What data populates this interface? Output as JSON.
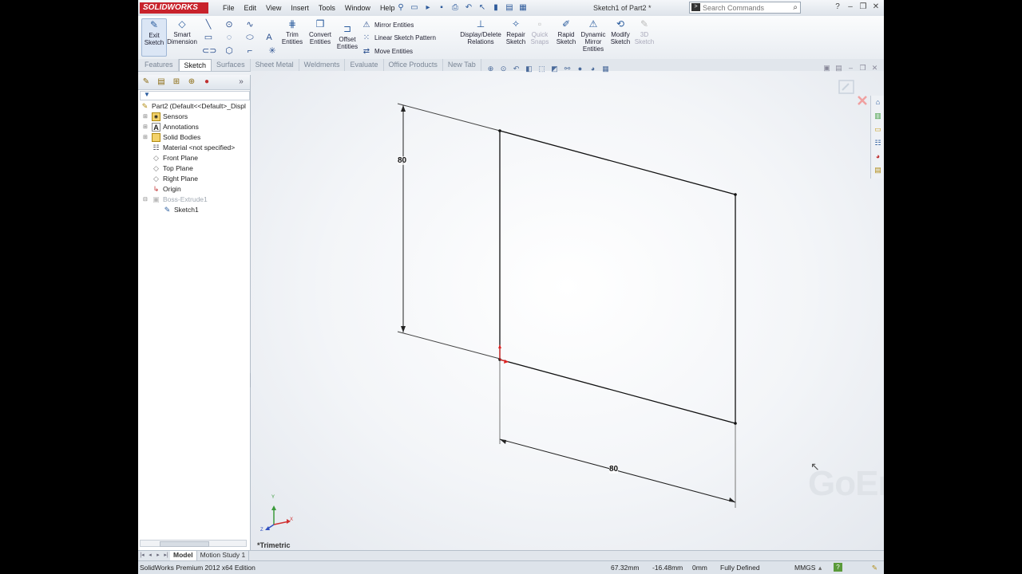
{
  "app": {
    "logo": "SOLIDWORKS",
    "document_title": "Sketch1 of Part2 *"
  },
  "menu": [
    "File",
    "Edit",
    "View",
    "Insert",
    "Tools",
    "Window",
    "Help"
  ],
  "search": {
    "placeholder": "Search Commands"
  },
  "ribbon": {
    "exit_sketch": "Exit Sketch",
    "smart_dimension": "Smart Dimension",
    "trim_entities": "Trim Entities",
    "convert_entities": "Convert Entities",
    "offset_entities": "Offset Entities",
    "mirror_entities": "Mirror Entities",
    "linear_sketch_pattern": "Linear Sketch Pattern",
    "move_entities": "Move Entities",
    "display_delete_relations": "Display/Delete Relations",
    "repair_sketch": "Repair Sketch",
    "quick_snaps": "Quick Snaps",
    "rapid_sketch": "Rapid Sketch",
    "dynamic_mirror_entities": "Dynamic Mirror Entities",
    "modify_sketch": "Modify Sketch",
    "sketch_3d": "3D Sketch"
  },
  "tabs": [
    "Features",
    "Sketch",
    "Surfaces",
    "Sheet Metal",
    "Weldments",
    "Evaluate",
    "Office Products",
    "New Tab"
  ],
  "active_tab": "Sketch",
  "tree": [
    {
      "label": "Part2  (Default<<Default>_Displ",
      "icon": "part-icon"
    },
    {
      "label": "Sensors",
      "icon": "sensor-icon"
    },
    {
      "label": "Annotations",
      "icon": "annotation-icon"
    },
    {
      "label": "Solid Bodies",
      "icon": "solid-bodies-icon"
    },
    {
      "label": "Material <not specified>",
      "icon": "material-icon"
    },
    {
      "label": "Front Plane",
      "icon": "plane-icon"
    },
    {
      "label": "Top Plane",
      "icon": "plane-icon"
    },
    {
      "label": "Right Plane",
      "icon": "plane-icon"
    },
    {
      "label": "Origin",
      "icon": "origin-icon"
    },
    {
      "label": "Boss-Extrude1",
      "icon": "extrude-icon"
    },
    {
      "label": "Sketch1",
      "icon": "sketch-icon"
    }
  ],
  "viewport": {
    "dimension_vertical": "80",
    "dimension_horizontal": "80",
    "view_label": "*Trimetric",
    "watermark": "GoEngineer",
    "triad": {
      "x": "X",
      "y": "Y",
      "z": "Z"
    }
  },
  "bottom_tabs": [
    "Model",
    "Motion Study 1"
  ],
  "status": {
    "edition": "SolidWorks Premium 2012 x64 Edition",
    "x": "67.32mm",
    "y": "-16.48mm",
    "z": "0mm",
    "state": "Fully Defined",
    "units": "MMGS"
  }
}
